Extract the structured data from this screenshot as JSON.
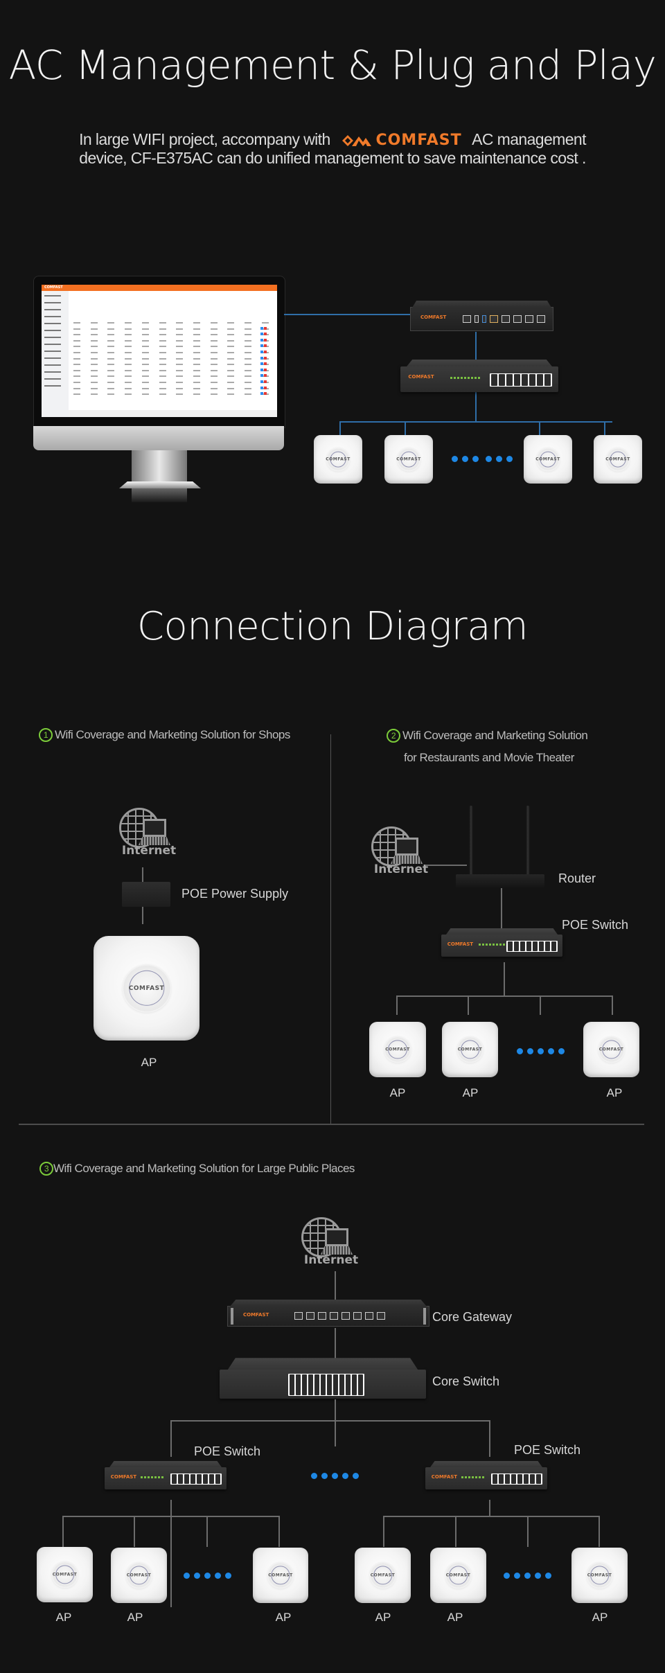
{
  "hero": {
    "title": "AC Management & Plug and Play",
    "intro_before_logo": "In large WIFI project, accompany with",
    "brand_name": "COMFAST",
    "intro_after_logo": "AC management",
    "intro_line2": "device, CF-E375AC can do unified management to save maintenance cost .",
    "brand_color": "#f07a2a",
    "link_color": "#2f6ea8",
    "ap_dots_color": "#1e88e5"
  },
  "connection": {
    "title": "Connection Diagram",
    "accent_color": "#7ccc3a",
    "scenario1": {
      "number": "1",
      "title": "Wifi Coverage and Marketing Solution for Shops",
      "internet_label": "Internet",
      "poe_label": "POE Power Supply",
      "ap_label": "AP"
    },
    "scenario2": {
      "number": "2",
      "title_line1": "Wifi Coverage and Marketing Solution",
      "title_line2": "for Restaurants and Movie Theater",
      "internet_label": "Internet",
      "router_label": "Router",
      "poe_switch_label": "POE Switch",
      "ap_labels": [
        "AP",
        "AP",
        "AP"
      ]
    },
    "scenario3": {
      "number": "3",
      "title": "Wifi Coverage and Marketing Solution for Large Public Places",
      "internet_label": "Internet",
      "core_gateway_label": "Core Gateway",
      "core_switch_label": "Core Switch",
      "poe_switch_left_label": "POE Switch",
      "poe_switch_right_label": "POE Switch",
      "ap_labels_left": [
        "AP",
        "AP",
        "AP"
      ],
      "ap_labels_right": [
        "AP",
        "AP",
        "AP"
      ]
    }
  },
  "device_branding": {
    "ap_logo": "COMFAST",
    "switch_logo": "COMFAST"
  }
}
